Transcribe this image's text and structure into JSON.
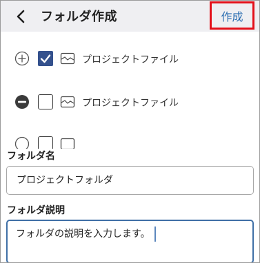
{
  "header": {
    "title": "フォルダ作成",
    "create_label": "作成",
    "icons": {
      "back": "chevron-left-icon"
    }
  },
  "list": {
    "items": [
      {
        "label": "プロジェクトファイル",
        "control": "plus-circle-icon",
        "checked": true
      },
      {
        "label": "プロジェクトファイル",
        "control": "minus-circle-icon",
        "checked": false
      },
      {
        "label": "",
        "control": "plus-circle-icon",
        "checked": false
      }
    ]
  },
  "form": {
    "name_label": "フォルダ名",
    "name_value": "プロジェクトフォルダ",
    "desc_label": "フォルダ説明",
    "desc_value": "フォルダの説明を入力します。"
  },
  "colors": {
    "accent": "#2d6fb2",
    "highlight": "#e3101a",
    "checkbox_checked": "#34518d",
    "focus_border": "#3f6fa6"
  }
}
